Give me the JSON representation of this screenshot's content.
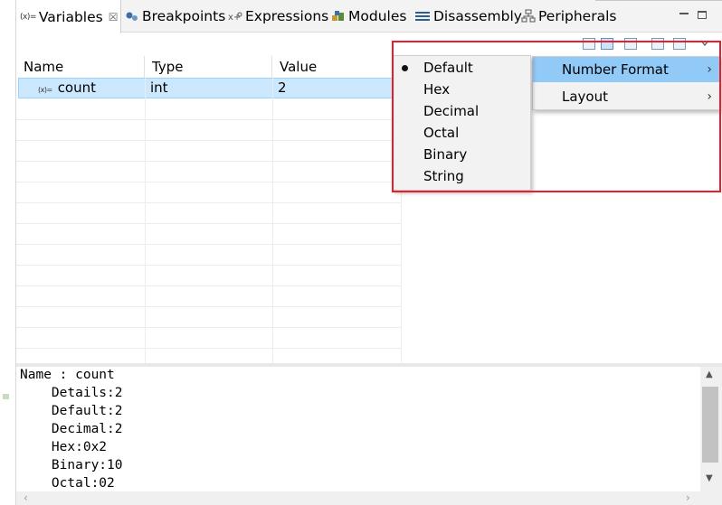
{
  "tabs": [
    {
      "label": "Variables",
      "active": true,
      "icon": "variables-icon",
      "closable": true
    },
    {
      "label": "Breakpoints",
      "active": false,
      "icon": "breakpoints-icon"
    },
    {
      "label": "Expressions",
      "active": false,
      "icon": "expressions-icon"
    },
    {
      "label": "Modules",
      "active": false,
      "icon": "modules-icon"
    },
    {
      "label": "Disassembly",
      "active": false,
      "icon": "disassembly-icon"
    },
    {
      "label": "Peripherals",
      "active": false,
      "icon": "peripherals-icon"
    }
  ],
  "tab_icon_text": "(x)=",
  "close_glyph": "☒",
  "table": {
    "columns": [
      "Name",
      "Type",
      "Value"
    ],
    "rows": [
      {
        "icon_text": "(x)=",
        "name": "count",
        "type": "int",
        "value": "2"
      }
    ]
  },
  "detail": {
    "lines": [
      "Name : count",
      "    Details:2",
      "    Default:2",
      "    Decimal:2",
      "    Hex:0x2",
      "    Binary:10",
      "    Octal:02"
    ]
  },
  "context_menu": {
    "items": [
      {
        "label": "Number Format",
        "highlighted": true,
        "submenu_glyph": "›"
      },
      {
        "label": "Layout",
        "highlighted": false,
        "submenu_glyph": "›"
      }
    ]
  },
  "number_format_submenu": {
    "selected": "Default",
    "options": [
      "Default",
      "Hex",
      "Decimal",
      "Octal",
      "Binary",
      "String"
    ]
  },
  "colors": {
    "selection": "#cce8ff",
    "menu_highlight": "#91c9f7",
    "annotation": "#e81e2b"
  }
}
